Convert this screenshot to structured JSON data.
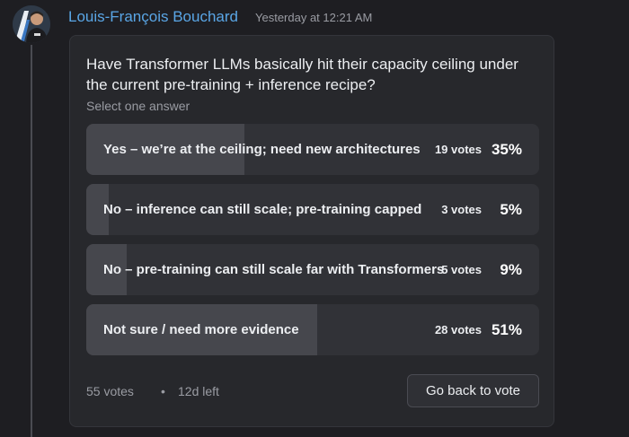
{
  "message": {
    "author": "Louis-François Bouchard",
    "timestamp": "Yesterday at 12:21 AM",
    "author_color": "#5aa6e6"
  },
  "poll": {
    "question": "Have Transformer LLMs basically hit their capacity ceiling under the current pre-training + inference recipe?",
    "hint": "Select one answer",
    "options": [
      {
        "label": "Yes – we’re at the ceiling; need new architectures",
        "votes": "19 votes",
        "percent": "35%",
        "share": 0.35
      },
      {
        "label": "No – inference can still scale; pre-training capped",
        "votes": "3 votes",
        "percent": "5%",
        "share": 0.05
      },
      {
        "label": "No – pre-training can still scale far with Transformers",
        "votes": "5 votes",
        "percent": "9%",
        "share": 0.09
      },
      {
        "label": "Not sure / need more evidence",
        "votes": "28 votes",
        "percent": "51%",
        "share": 0.51
      }
    ],
    "total_votes": "55 votes",
    "separator": "•",
    "time_left": "12d left",
    "button_label": "Go back to vote"
  }
}
